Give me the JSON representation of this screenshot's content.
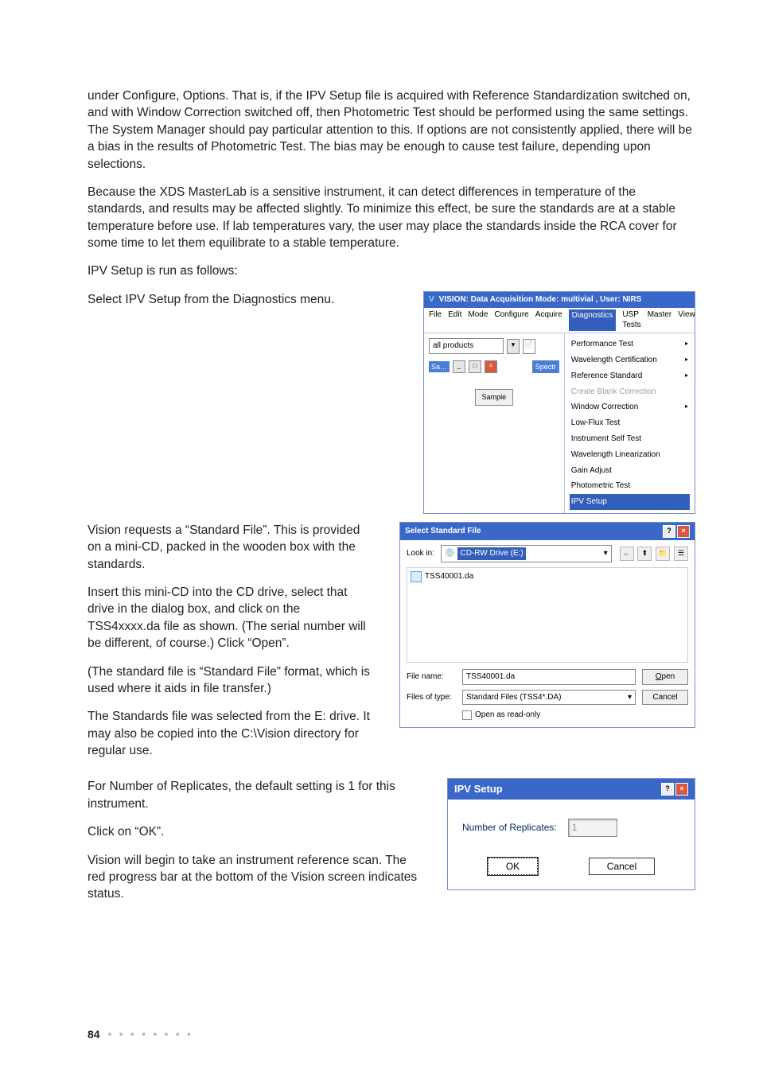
{
  "paragraphs": {
    "p1": "under Configure, Options. That is, if the IPV Setup file is acquired with Reference Standardization switched on, and with Window Correction switched off, then Photometric Test should be performed using the same settings. The System Manager should pay particular attention to this. If options are not consistently applied, there will be a bias in the results of Photometric Test. The bias may be enough to cause test failure, depending upon selections.",
    "p2": "Because the XDS MasterLab is a sensitive instrument, it can detect differences in temperature of the standards, and results may be affected slightly. To minimize this effect, be sure the standards are at a stable temperature before use. If lab temperatures vary, the user may place the standards inside the RCA cover for some time to let them equilibrate to a stable temperature.",
    "p3": "IPV Setup is run as follows:",
    "p4": "Select IPV Setup from the Diagnostics menu.",
    "p5": "Vision requests a “Standard File”. This is provided on a mini-CD, packed in the wooden box with the standards.",
    "p6": "Insert this mini-CD into the CD drive, select that drive in the dialog box, and click on the TSS4xxxx.da file as shown. (The serial number will be different, of course.) Click “Open”.",
    "p7": "(The standard file is “Standard File” format, which is used where it aids in file transfer.)",
    "p8": "The Standards file was selected from the E: drive. It may also be copied into the C:\\Vision directory for regular use.",
    "p9": "For Number of Replicates, the default setting is 1 for this instrument.",
    "p10": "Click on “OK”.",
    "p11": "Vision will begin to take an instrument reference scan. The red progress bar at the bottom of the Vision screen indicates status."
  },
  "menu_shot": {
    "title": "VISION: Data Acquisition Mode: multivial , User: NIRS",
    "menubar": [
      "File",
      "Edit",
      "Mode",
      "Configure",
      "Acquire",
      "Diagnostics",
      "USP Tests",
      "Master",
      "View"
    ],
    "menubar_highlighted": "Diagnostics",
    "product_dropdown": "all products",
    "tabs": {
      "sa": "Sa…",
      "spectr": "Spectr"
    },
    "sample_btn": "Sample",
    "items": [
      {
        "label": "Performance Test",
        "sub": true
      },
      {
        "label": "Wavelength Certification",
        "sub": true
      },
      {
        "label": "Reference Standard",
        "sub": true
      },
      {
        "label": "Create Blank Correction",
        "disabled": true
      },
      {
        "label": "Window Correction",
        "sub": true
      },
      {
        "label": "Low-Flux Test"
      },
      {
        "label": "Instrument Self Test"
      },
      {
        "label": "Wavelength Linearization"
      },
      {
        "label": "Gain Adjust"
      },
      {
        "label": "Photometric Test"
      },
      {
        "label": "IPV Setup",
        "selected": true
      }
    ]
  },
  "file_shot": {
    "title": "Select Standard File",
    "look_in_label": "Look in:",
    "look_in_value": "CD-RW Drive (E:)",
    "file_in_list": "TSS40001.da",
    "file_name_label": "File name:",
    "file_name_value": "TSS40001.da",
    "file_type_label": "Files of type:",
    "file_type_value": "Standard Files (TSS4*.DA)",
    "open_btn": "Open",
    "cancel_btn": "Cancel",
    "readonly_label": "Open as read-only"
  },
  "ipv_shot": {
    "title": "IPV Setup",
    "label": "Number of Replicates:",
    "value": "1",
    "ok": "OK",
    "cancel": "Cancel"
  },
  "footer": {
    "page": "84",
    "dots": "▪ ▪ ▪ ▪ ▪ ▪ ▪ ▪"
  }
}
